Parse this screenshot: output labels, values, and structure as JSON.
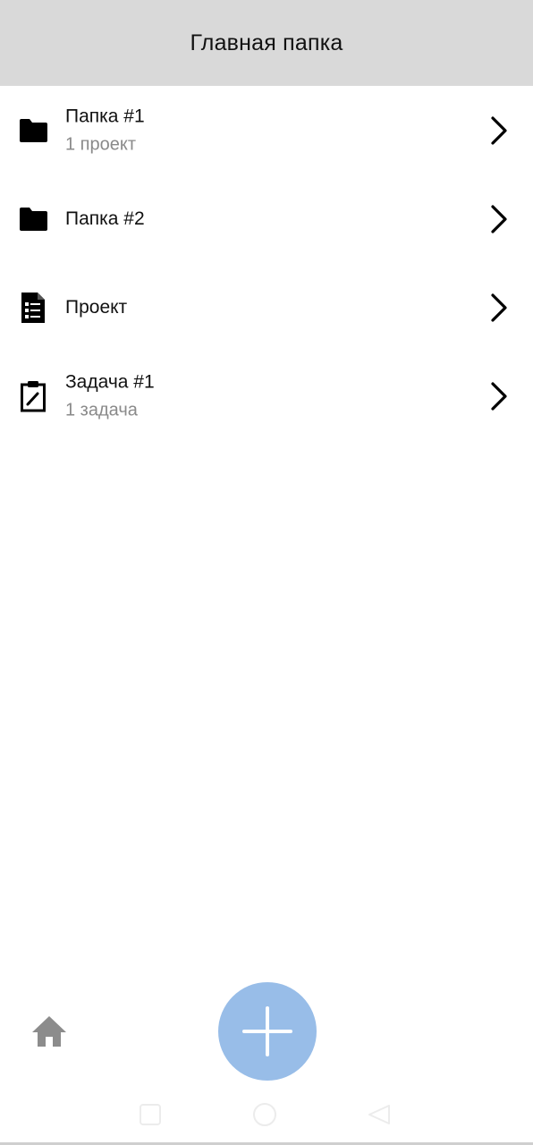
{
  "header": {
    "title": "Главная папка"
  },
  "items": [
    {
      "icon": "folder-icon",
      "title": "Папка #1",
      "subtitle": "1 проект"
    },
    {
      "icon": "folder-icon",
      "title": "Папка #2",
      "subtitle": ""
    },
    {
      "icon": "document-list-icon",
      "title": "Проект",
      "subtitle": ""
    },
    {
      "icon": "clipboard-edit-icon",
      "title": "Задача #1",
      "subtitle": "1 задача"
    }
  ],
  "bottom_bar": {
    "home_icon": "home-icon",
    "fab_icon": "plus-icon"
  },
  "colors": {
    "header_bg": "#d9d9d9",
    "fab_bg": "#98bde8",
    "subtitle": "#8a8a8a",
    "home_icon": "#8c8c8c"
  },
  "system_nav": {
    "recents_icon": "square-icon",
    "home_icon": "circle-icon",
    "back_icon": "triangle-back-icon"
  }
}
